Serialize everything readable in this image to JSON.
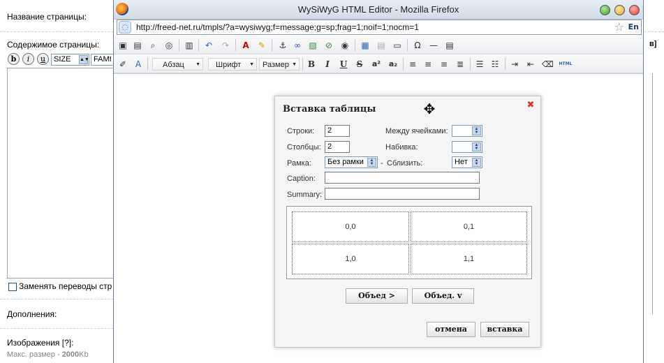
{
  "background": {
    "page_name_label": "Название страницы:",
    "content_label": "Содержимое страницы:",
    "fmt_buttons": [
      "b",
      "i",
      "u"
    ],
    "size_select": "SIZE",
    "family_select": "FAMI",
    "replace_breaks_label": "Заменять переводы стр",
    "additions_label": "Дополнения:",
    "images_label": "Изображения [?]:",
    "max_size_prefix": "Макс. размер - ",
    "max_size_value": "2000",
    "max_size_unit": "Kb",
    "right_bracket": "в]"
  },
  "browser": {
    "title": "WySiWyG HTML Editor - Mozilla Firefox",
    "url": "http://freed-net.ru/tmpls/?a=wysiwyg;f=message;g=sp;frag=1;noif=1;nocm=1",
    "lang": "En"
  },
  "toolbar": {
    "format_select": "Абзац",
    "font_select": "Шрифт",
    "size_select": "Размер",
    "bold": "B",
    "italic": "I",
    "underline": "U",
    "strike": "S",
    "superscript": "a²",
    "subscript": "a₂",
    "html": "HTML"
  },
  "dialog": {
    "title": "Вставка таблицы",
    "rows_label": "Строки:",
    "rows_value": "2",
    "cols_label": "Столбцы:",
    "cols_value": "2",
    "border_label": "Рамка:",
    "border_value": "Без рамки",
    "dash": "-",
    "spacing_label": "Между ячейками:",
    "spacing_value": "",
    "padding_label": "Набивка:",
    "padding_value": "",
    "collapse_label": "Сблизить:",
    "collapse_value": "Нет",
    "caption_label": "Caption:",
    "caption_value": "",
    "summary_label": "Summary:",
    "summary_value": "",
    "cells": [
      "0,0",
      "0,1",
      "1,0",
      "1,1"
    ],
    "merge_right": "Объед >",
    "merge_down": "Объед. v",
    "cancel": "отмена",
    "insert": "вставка"
  }
}
